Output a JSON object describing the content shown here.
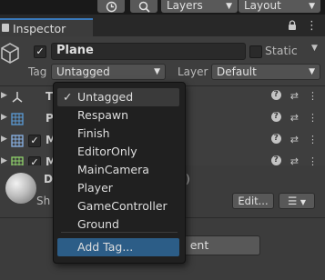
{
  "toolbar": {
    "history_icon": "history-icon",
    "search_icon": "search-icon",
    "layers_label": "Layers",
    "layout_label": "Layout"
  },
  "tab": {
    "title": "Inspector",
    "icon": "inspector-icon",
    "lock_icon": "lock-icon"
  },
  "object": {
    "active_checked": true,
    "name": "Plane",
    "static_label": "Static",
    "tag_label": "Tag",
    "tag_value": "Untagged",
    "layer_label": "Layer",
    "layer_value": "Default"
  },
  "components": [
    {
      "icon": "transform-icon",
      "label_fragment": "T"
    },
    {
      "icon": "mesh-filter-icon",
      "label_fragment": "P"
    },
    {
      "icon": "mesh-renderer-icon",
      "label_fragment": "M",
      "checked": true
    },
    {
      "icon": "mesh-collider-icon",
      "label_fragment": "M",
      "checked": true
    }
  ],
  "material": {
    "label_fragment": "D",
    "paren_fragment": ")",
    "shader_fragment": "Sh",
    "edit_label": "Edit...",
    "add_component_fragment": "ent"
  },
  "tag_menu": {
    "items": [
      "Untagged",
      "Respawn",
      "Finish",
      "EditorOnly",
      "MainCamera",
      "Player",
      "GameController",
      "Ground"
    ],
    "selected": "Untagged",
    "add_tag_label": "Add Tag...",
    "checkmark": "✓"
  },
  "colors": {
    "accent": "#3a79bb",
    "highlight": "#2c5d87",
    "panel": "#3e3e3e"
  }
}
